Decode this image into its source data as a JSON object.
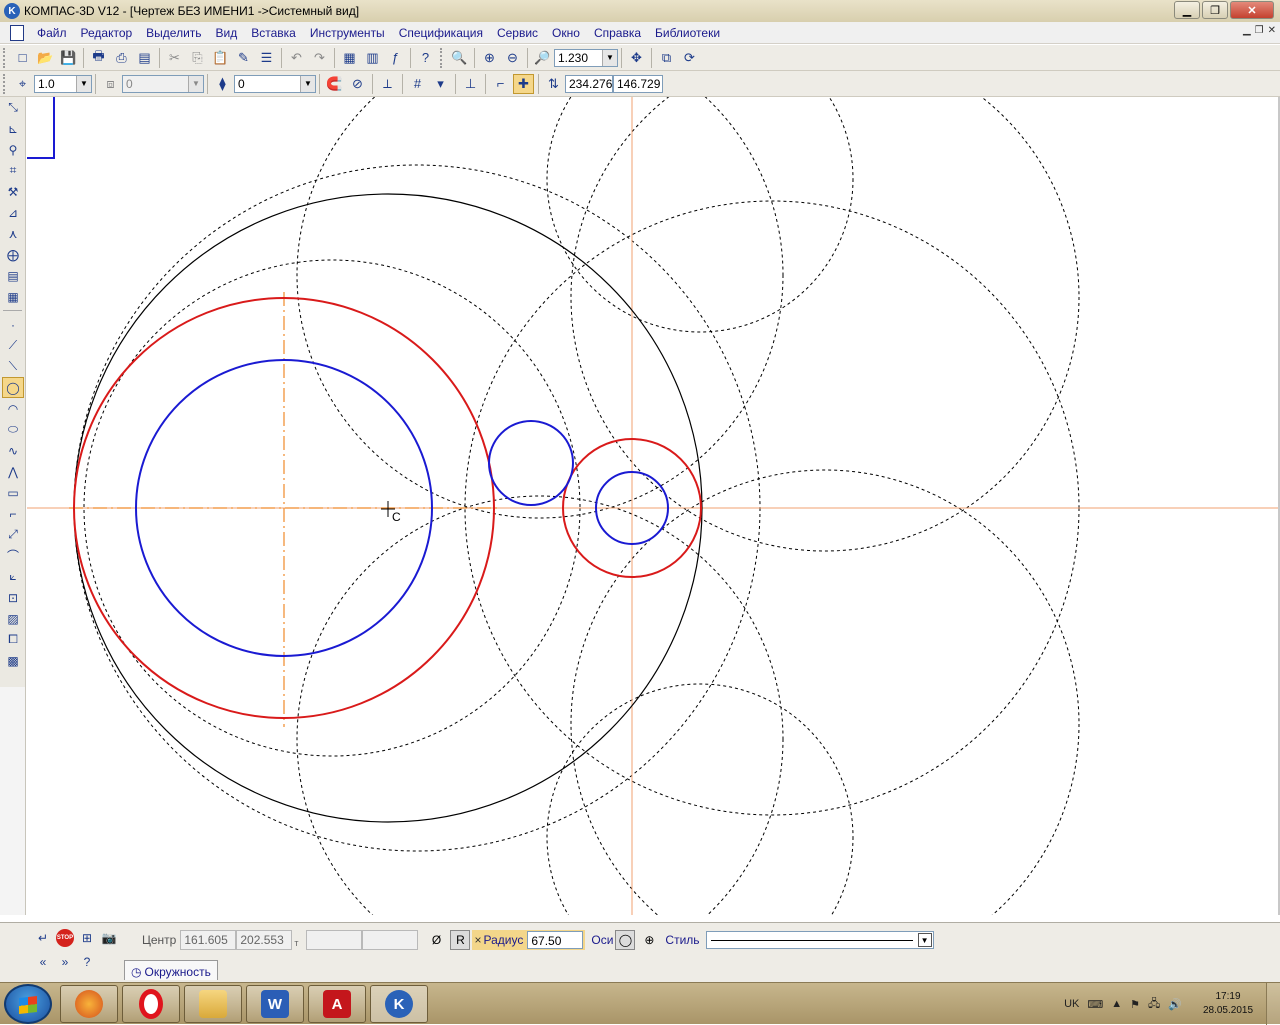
{
  "window": {
    "title": "КОМПАС-3D V12 - [Чертеж БЕЗ ИМЕНИ1 ->Системный вид]",
    "app_icon": "kompas-logo-icon",
    "minimize": "minimize-icon",
    "maximize": "restore-icon",
    "close": "close-icon"
  },
  "menu": {
    "items": [
      "Файл",
      "Редактор",
      "Выделить",
      "Вид",
      "Вставка",
      "Инструменты",
      "Спецификация",
      "Сервис",
      "Окно",
      "Справка",
      "Библиотеки"
    ]
  },
  "toolbar1": {
    "zoom_value": "1.230"
  },
  "toolbar2": {
    "step_value": "1.0",
    "layer_value": "0",
    "style_value": "0",
    "x_coord": "234.276",
    "y_coord": "146.729"
  },
  "drawing": {
    "cursor_label": "C",
    "colors": {
      "red_circle": "#d91a1a",
      "blue_circle": "#1a1ad2",
      "black_circle": "#000000",
      "axis_orange": "#f08a2a",
      "dashed": "#000000",
      "cursor_line": "#f0a070"
    }
  },
  "properties": {
    "center_label": "Центр",
    "center_x": "161.605",
    "center_y": "202.553",
    "t_label": "т",
    "radius_label": "Радиус",
    "radius_value": "67.50",
    "axes_label": "Оси",
    "style_label": "Стиль",
    "diameter_toggle": "Ø",
    "r_toggle": "R",
    "cross": "×"
  },
  "command_tab": {
    "label": "Окружность"
  },
  "taskbar": {
    "apps": [
      "firefox",
      "opera",
      "explorer",
      "word",
      "acrobat",
      "kompas"
    ],
    "lang": "UK",
    "time": "17:19",
    "date": "28.05.2015"
  }
}
